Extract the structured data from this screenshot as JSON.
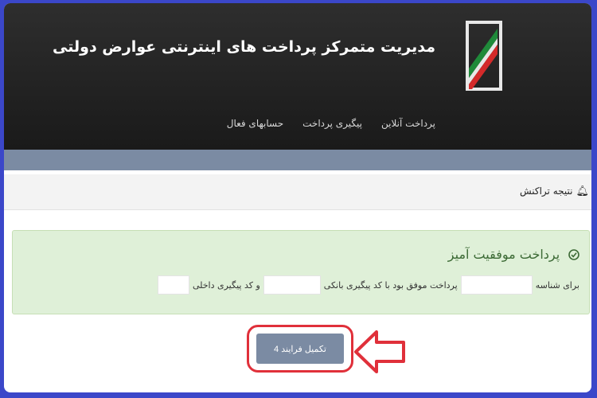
{
  "header": {
    "site_title": "مدیریت متمرکز پرداخت های اینترنتی عوارض دولتی",
    "nav": [
      "پرداخت آنلاین",
      "پیگیری پرداخت",
      "حسابهای فعال"
    ]
  },
  "result_bar": {
    "title": "نتیجه تراکنش",
    "icon": "bell-icon"
  },
  "alert": {
    "heading": "پرداخت موفقیت آمیز",
    "icon": "check-circle-icon",
    "text_part1": "برای شناسه",
    "text_part2": "پرداخت موفق بود با کد پیگیری بانکی",
    "text_part3": "و کد پیگیری داخلی"
  },
  "action": {
    "button_label": "تکمیل فرایند 4"
  },
  "colors": {
    "page_border": "#3b47c9",
    "header_bg": "#222222",
    "steel": "#7b8ba3",
    "success_bg": "#dff0d8",
    "success_text": "#3c6a35",
    "highlight_red": "#e0303a"
  }
}
